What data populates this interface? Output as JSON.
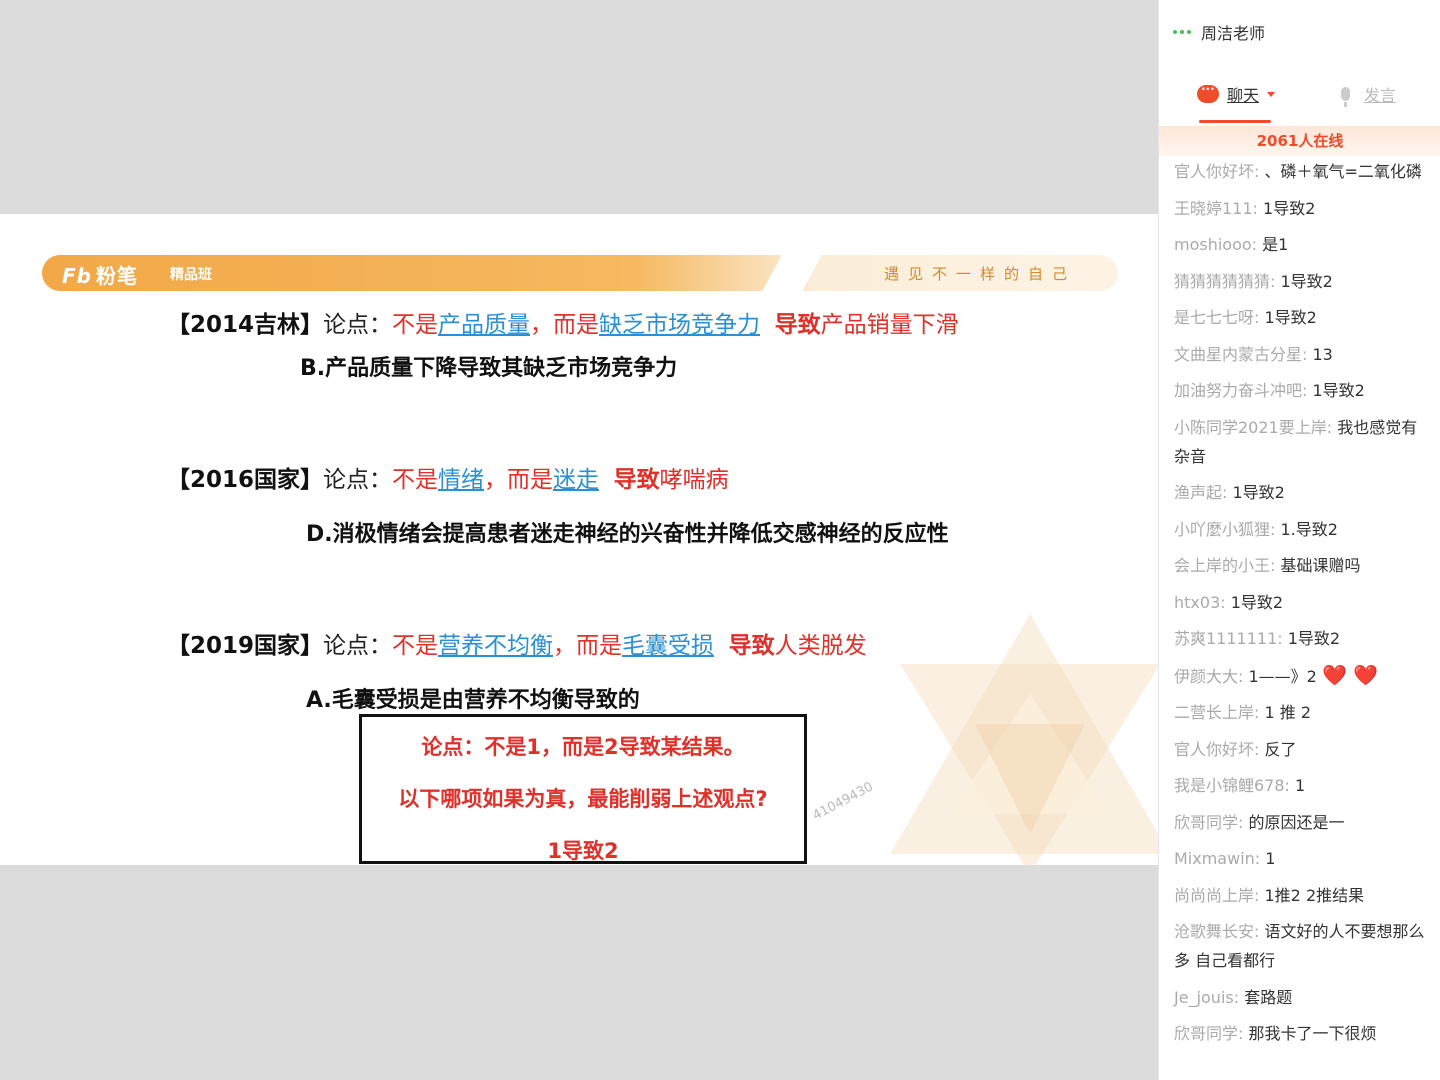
{
  "slide": {
    "logo": "粉笔",
    "logo_mark": "Fb",
    "class_tag": "精品班",
    "motto": "遇见不一样的自己",
    "q1": {
      "year": "【2014吉林】",
      "lead": "论点：",
      "a1": "不是",
      "b1": "产品质量",
      "a2": "，而是",
      "b2": "缺乏市场竞争力",
      "a3": "导致",
      "a4": "产品销量下滑",
      "option": "B.产品质量下降导致其缺乏市场竞争力"
    },
    "q2": {
      "year": "【2016国家】",
      "lead": "论点：",
      "a1": "不是",
      "b1": "情绪",
      "a2": "，而是",
      "b2": "迷走",
      "a3": "导致",
      "a4": "哮喘病",
      "option": "D.消极情绪会提高患者迷走神经的兴奋性并降低交感神经的反应性"
    },
    "q3": {
      "year": "【2019国家】",
      "lead": "论点：",
      "a1": "不是",
      "b1": "营养不均衡",
      "a2": "，而是",
      "b2": "毛囊受损",
      "a3": "导致",
      "a4": "人类脱发",
      "option": "A.毛囊受损是由营养不均衡导致的"
    },
    "note": {
      "line1": "论点：不是1，而是2导致某结果。",
      "line2": "以下哪项如果为真，最能削弱上述观点?",
      "line3": "1导致2"
    },
    "watermark": "41049430"
  },
  "chat": {
    "teacher": "周洁老师",
    "tab_chat": "聊天",
    "tab_speak": "发言",
    "online": "2061人在线",
    "messages": [
      {
        "user": "官人你好坏:",
        "text": " 、磷＋氧气=二氧化磷"
      },
      {
        "user": "王晓婷111:",
        "text": " 1导致2"
      },
      {
        "user": "moshiooo:",
        "text": " 是1"
      },
      {
        "user": "猜猜猜猜猜猜:",
        "text": " 1导致2"
      },
      {
        "user": "是七七七呀:",
        "text": " 1导致2"
      },
      {
        "user": "文曲星内蒙古分星:",
        "text": " 13"
      },
      {
        "user": "加油努力奋斗冲吧:",
        "text": " 1导致2"
      },
      {
        "user": "小陈同学2021要上岸:",
        "text": " 我也感觉有杂音"
      },
      {
        "user": "渔声起:",
        "text": " 1导致2"
      },
      {
        "user": "小吖麼小狐狸:",
        "text": " 1.导致2"
      },
      {
        "user": "会上岸的小王:",
        "text": " 基础课赠吗"
      },
      {
        "user": "htx03:",
        "text": " 1导致2"
      },
      {
        "user": "苏爽1111111:",
        "text": " 1导致2"
      },
      {
        "user": "伊颜大大:",
        "text": " 1——》2 ",
        "hearts": "❤️ ❤️"
      },
      {
        "user": "二营长上岸:",
        "text": " 1 推 2"
      },
      {
        "user": "官人你好坏:",
        "text": " 反了"
      },
      {
        "user": "我是小锦鲤678:",
        "text": " 1"
      },
      {
        "user": "欣哥同学:",
        "text": " 的原因还是一"
      },
      {
        "user": "Mixmawin:",
        "text": " 1"
      },
      {
        "user": "尚尚尚上岸:",
        "text": " 1推2 2推结果"
      },
      {
        "user": "沧歌舞长安:",
        "text": " 语文好的人不要想那么多 自己看都行"
      },
      {
        "user": "Je_jouis:",
        "text": " 套路题"
      },
      {
        "user": "欣哥同学:",
        "text": " 那我卡了一下很烦"
      }
    ]
  }
}
